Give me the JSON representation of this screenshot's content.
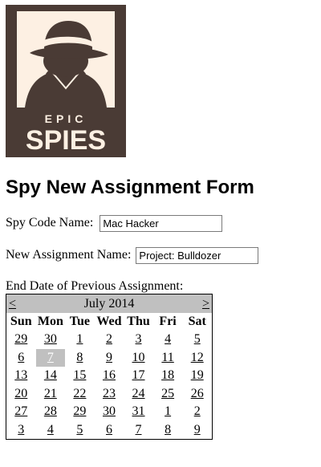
{
  "logo": {
    "line1": "EPIC",
    "line2": "SPIES",
    "colors": {
      "background": "#4a3b35",
      "foreground": "#fdf0e3"
    }
  },
  "form": {
    "title": "Spy New Assignment Form",
    "code_name_label": "Spy Code Name:",
    "code_name_value": "Mac Hacker",
    "assignment_label": "New Assignment Name:",
    "assignment_value": "Project: Bulldozer",
    "end_date_label": "End Date of Previous Assignment:"
  },
  "calendar": {
    "prev": "<",
    "next": ">",
    "month_title": "July 2014",
    "weekdays": [
      "Sun",
      "Mon",
      "Tue",
      "Wed",
      "Thu",
      "Fri",
      "Sat"
    ],
    "weeks": [
      [
        "29",
        "30",
        "1",
        "2",
        "3",
        "4",
        "5"
      ],
      [
        "6",
        "7",
        "8",
        "9",
        "10",
        "11",
        "12"
      ],
      [
        "13",
        "14",
        "15",
        "16",
        "17",
        "18",
        "19"
      ],
      [
        "20",
        "21",
        "22",
        "23",
        "24",
        "25",
        "26"
      ],
      [
        "27",
        "28",
        "29",
        "30",
        "31",
        "1",
        "2"
      ],
      [
        "3",
        "4",
        "5",
        "6",
        "7",
        "8",
        "9"
      ]
    ],
    "selected_day": "7",
    "colors": {
      "header_bg": "#c0c0c0",
      "selected_bg": "#c0c0c0",
      "selected_text": "#ffffff"
    }
  }
}
